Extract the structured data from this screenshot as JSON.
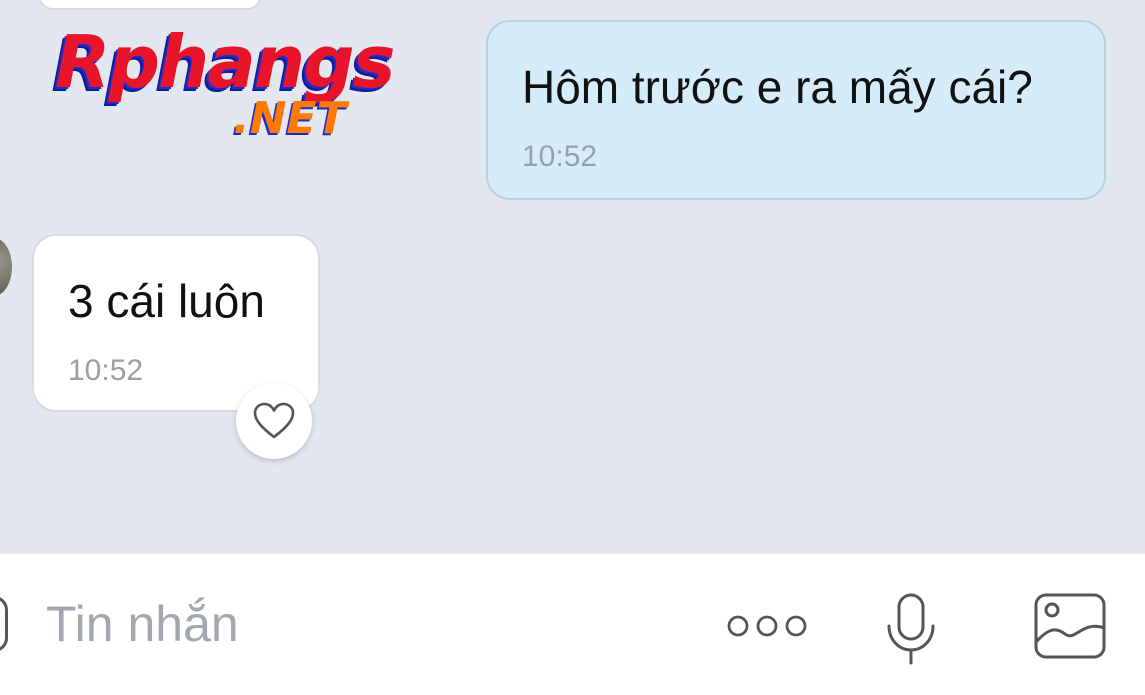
{
  "logo": {
    "main": "Rphangs",
    "suffix": ".NET"
  },
  "messages": {
    "outgoing": {
      "text": "Hôm trước e ra mấy cái?",
      "time": "10:52"
    },
    "incoming": {
      "text": "3 cái luôn",
      "time": "10:52"
    }
  },
  "composer": {
    "placeholder": "Tin nhắn",
    "value": ""
  },
  "icons": {
    "reaction": "heart-icon",
    "more": "more-dots-icon",
    "voice": "microphone-icon",
    "attach": "image-icon",
    "left": "sticker-icon"
  },
  "colors": {
    "chat_background": "#e3e7ef",
    "outgoing_bubble": "#d7ecfb",
    "incoming_bubble": "#ffffff",
    "timestamp": "#9aa0a8",
    "placeholder": "#a3a8b0"
  }
}
